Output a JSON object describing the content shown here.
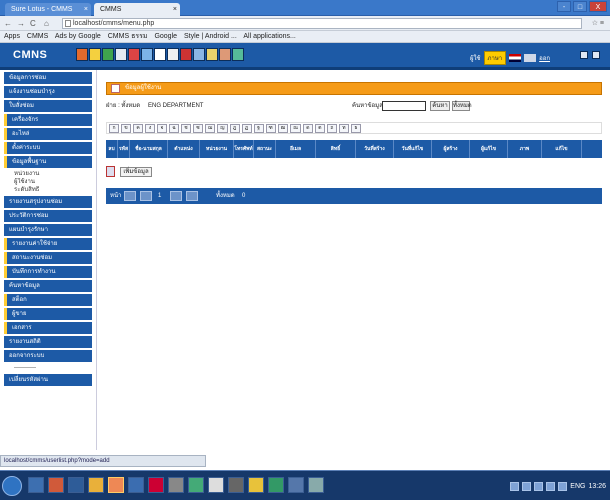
{
  "browser": {
    "tabs": [
      {
        "label": "Sure Lotus - CMMS"
      },
      {
        "label": "CMMS"
      }
    ],
    "address": "localhost/cmms/menu.php",
    "bookmarks": [
      "Apps",
      "CMMS",
      "Ads by Google",
      "CMMS ธรรม",
      "Google",
      "Style | Android ...",
      "All applications..."
    ],
    "window_controls": [
      "-",
      "□",
      "X"
    ]
  },
  "header": {
    "logo": "CMNS",
    "icons": [
      "doc-icon",
      "star-icon",
      "chart-icon",
      "mail-icon",
      "group-icon",
      "box-icon",
      "pdf-icon",
      "calendar-icon",
      "report-icon",
      "print-icon",
      "tools-icon",
      "people-icon",
      "check-icon"
    ],
    "user_label": "ผู้ใช้",
    "badge": "ภาษา",
    "logout": "ออก"
  },
  "sidebar": {
    "items": [
      {
        "label": "ข้อมูลการซ่อม",
        "style": "block"
      },
      {
        "label": "แจ้งงานซ่อมบำรุง",
        "style": "block"
      },
      {
        "label": "ใบสั่งซ่อม",
        "style": "block"
      },
      {
        "label": "เครื่องจักร",
        "style": "mark"
      },
      {
        "label": "อะไหล่",
        "style": "mark"
      },
      {
        "label": "ตั้งค่าระบบ",
        "style": "mark"
      },
      {
        "label": "ข้อมูลพื้นฐาน",
        "style": "mark"
      },
      {
        "label": "หน่วยงาน",
        "style": "plain"
      },
      {
        "label": "ผู้ใช้งาน",
        "style": "plain"
      },
      {
        "label": "ระดับสิทธิ์",
        "style": "plain"
      },
      {
        "label": "รายงานสรุปงานซ่อม",
        "style": "block"
      },
      {
        "label": "ประวัติการซ่อม",
        "style": "block"
      },
      {
        "label": "แผนบำรุงรักษา",
        "style": "block"
      },
      {
        "label": "รายงานค่าใช้จ่าย",
        "style": "mark"
      },
      {
        "label": "สถานะงานซ่อม",
        "style": "mark"
      },
      {
        "label": "บันทึกการทำงาน",
        "style": "mark"
      },
      {
        "label": "ค้นหาข้อมูล",
        "style": "block"
      },
      {
        "label": "สต็อก",
        "style": "mark"
      },
      {
        "label": "ผู้ขาย",
        "style": "mark"
      },
      {
        "label": "เอกสาร",
        "style": "mark"
      },
      {
        "label": "รายงานสถิติ",
        "style": "block"
      },
      {
        "label": "ออกจากระบบ",
        "style": "block"
      },
      {
        "label": "-----------",
        "style": "plain"
      },
      {
        "label": "เปลี่ยนรหัสผ่าน",
        "style": "block"
      }
    ]
  },
  "main": {
    "panel_title": "ข้อมูลผู้ใช้งาน",
    "filter": {
      "label": "ฝ่าย :",
      "value": "ทั้งหมด",
      "selected": "ENG DEPARTMENT",
      "search_label": "ค้นหาข้อมูล",
      "search_value": "",
      "search_button": "ค้นหา",
      "all_button": "ทั้งหมด"
    },
    "alphabet": [
      "ก",
      "ข",
      "ค",
      "ง",
      "จ",
      "ฉ",
      "ช",
      "ซ",
      "ฌ",
      "ญ",
      "ฎ",
      "ฏ",
      "ฐ",
      "ฑ",
      "ฒ",
      "ณ",
      "ด",
      "ต",
      "ถ",
      "ท",
      "ธ"
    ],
    "columns": [
      "ลบ",
      "รหัส",
      "ชื่อ-นามสกุล",
      "ตำแหน่ง",
      "หน่วยงาน",
      "โทรศัพท์",
      "สถานะ",
      "อีเมล",
      "สิทธิ์",
      "วันที่สร้าง",
      "วันที่แก้ไข",
      "ผู้สร้าง",
      "ผู้แก้ไข",
      "ภาพ",
      "แก้ไข"
    ],
    "add_button": "เพิ่มข้อมูล",
    "pager": {
      "page": "1",
      "total_text": "ทั้งหมด",
      "count": "0",
      "label": "หน้า"
    }
  },
  "status_url": "localhost/cmms/userlist.php?mode=add",
  "taskbar": {
    "lang": "ENG",
    "time": "13:26"
  }
}
